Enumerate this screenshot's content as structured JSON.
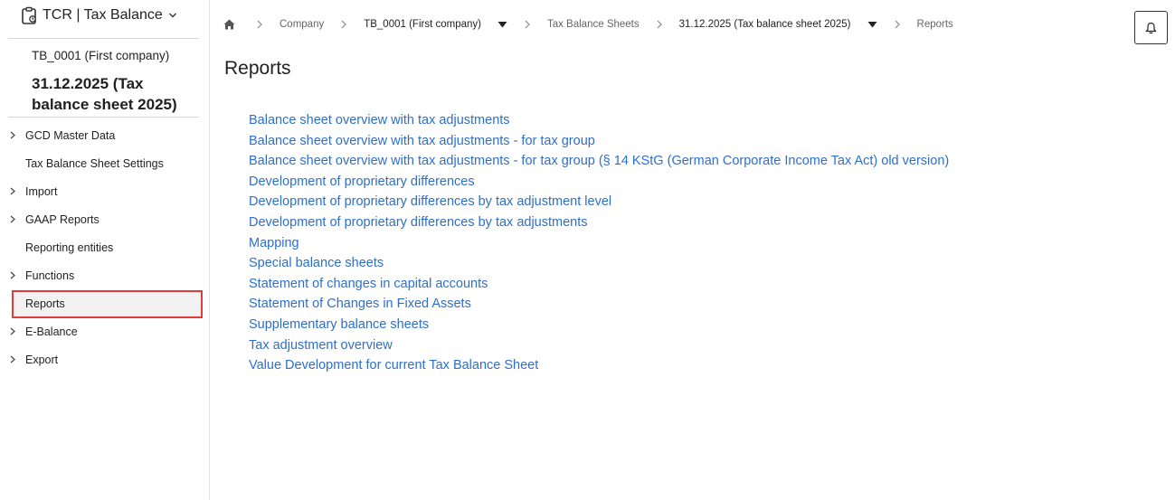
{
  "app": {
    "name": "TCR | Tax Balance"
  },
  "context": {
    "company": "TB_0001 (First company)",
    "sheet": "31.12.2025 (Tax balance sheet 2025)"
  },
  "sidebar": {
    "items": [
      {
        "label": "GCD Master Data",
        "expandable": true
      },
      {
        "label": "Tax Balance Sheet Settings",
        "expandable": false
      },
      {
        "label": "Import",
        "expandable": true
      },
      {
        "label": "GAAP Reports",
        "expandable": true
      },
      {
        "label": "Reporting entities",
        "expandable": false
      },
      {
        "label": "Functions",
        "expandable": true
      },
      {
        "label": "Reports",
        "expandable": false,
        "active": true
      },
      {
        "label": "E-Balance",
        "expandable": true
      },
      {
        "label": "Export",
        "expandable": true
      }
    ]
  },
  "breadcrumb": {
    "company": "Company",
    "company_value": "TB_0001 (First company)",
    "sheets": "Tax Balance Sheets",
    "sheet_value": "31.12.2025 (Tax balance sheet 2025)",
    "current": "Reports"
  },
  "main": {
    "title": "Reports",
    "reports": [
      "Balance sheet overview with tax adjustments",
      "Balance sheet overview with tax adjustments - for tax group",
      "Balance sheet overview with tax adjustments - for tax group (§ 14 KStG (German Corporate Income Tax Act) old version)",
      "Development of proprietary differences",
      "Development of proprietary differences by tax adjustment level",
      "Development of proprietary differences by tax adjustments",
      "Mapping",
      "Special balance sheets",
      "Statement of changes in capital accounts",
      "Statement of Changes in Fixed Assets",
      "Supplementary balance sheets",
      "Tax adjustment overview",
      "Value Development for current Tax Balance Sheet"
    ]
  },
  "icons": {
    "app": "clipboard-icon",
    "home": "home-icon",
    "notifications": "bell-icon"
  },
  "colors": {
    "link": "#2f6fc8",
    "active_outline": "#e23b3b",
    "active_bg": "#f2f2f2"
  }
}
